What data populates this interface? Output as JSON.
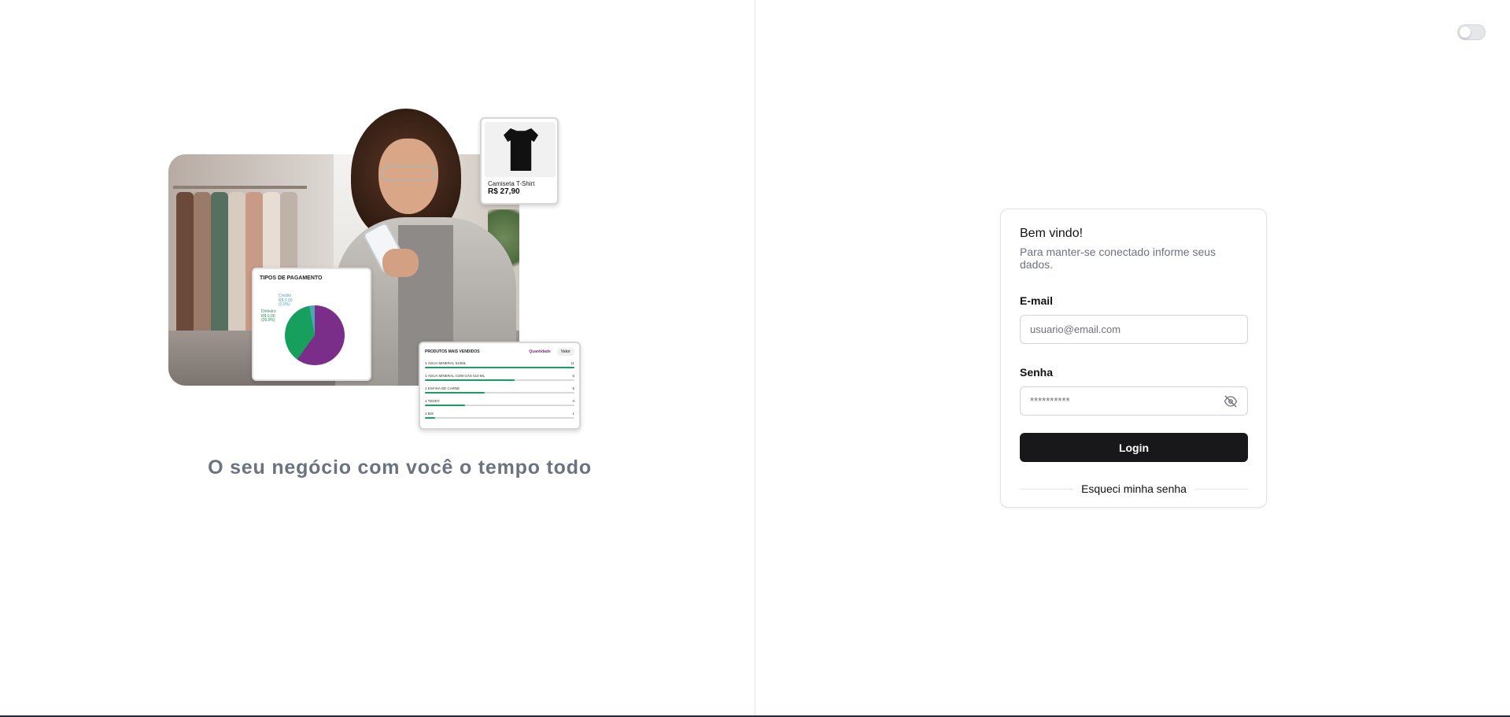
{
  "hero": {
    "product_card": {
      "name": "Camiseta T-Shirt",
      "price": "R$ 27,90"
    },
    "payment_card": {
      "title": "TIPOS DE PAGAMENTO",
      "label_credit": "Crédito\nR$ 0,00\n(3,0%)",
      "label_cash": "Dinheiro\nR$ 0,00\n(36,9%)"
    },
    "top_products_card": {
      "title": "PRODUTOS MAIS VENDIDOS",
      "tab_quantity": "Quantidade",
      "tab_value": "Valor",
      "rows": [
        {
          "label": "1 ÁGUA MINERAL 510ML",
          "value": "11",
          "fill": 1.0
        },
        {
          "label": "1 ÁGUA MINERAL COM GÁS 510 ML",
          "value": "6",
          "fill": 0.6
        },
        {
          "label": "1 ESFIHA DE CARNE",
          "value": "6",
          "fill": 0.4
        },
        {
          "label": "1 TEDDY",
          "value": "4",
          "fill": 0.27
        },
        {
          "label": "1 BIS",
          "value": "1",
          "fill": 0.07
        }
      ]
    },
    "tagline": "O seu negócio com você o tempo todo"
  },
  "login": {
    "title": "Bem vindo!",
    "subtitle": "Para manter-se conectado informe seus dados.",
    "email_label": "E-mail",
    "email_placeholder": "usuario@email.com",
    "password_label": "Senha",
    "password_placeholder": "**********",
    "login_button": "Login",
    "forgot_password": "Esqueci minha senha"
  },
  "theme_toggle": {
    "enabled": false
  },
  "colors": {
    "primary": "#18181b",
    "accent_green": "#17a05d",
    "accent_purple": "#7b2d8a",
    "muted_text": "#6b7280"
  }
}
